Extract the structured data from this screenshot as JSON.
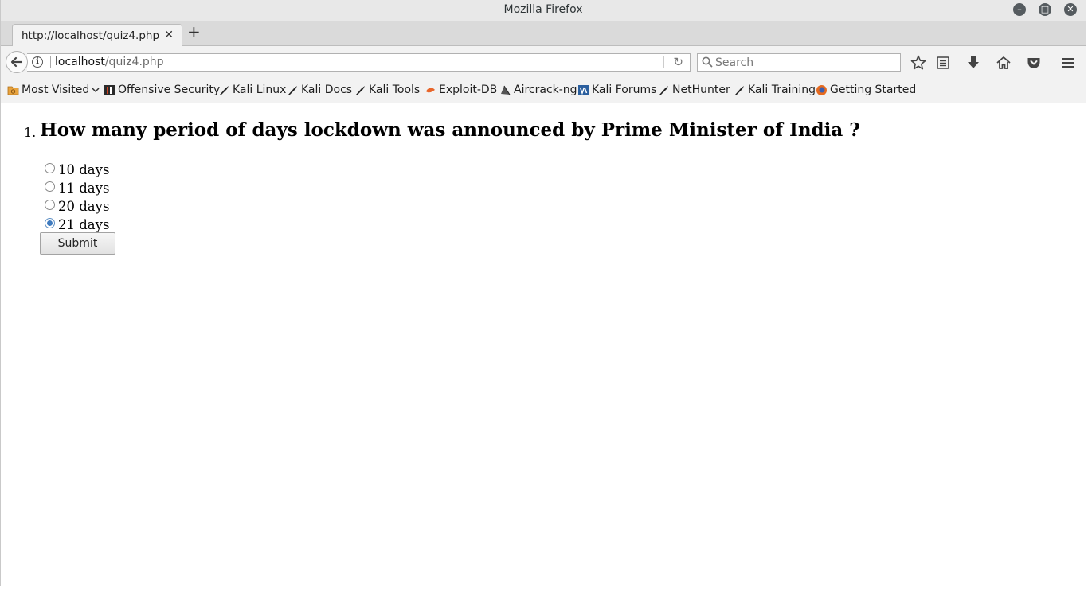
{
  "window": {
    "title": "Mozilla Firefox"
  },
  "tab": {
    "title": "http://localhost/quiz4.php"
  },
  "navbar": {
    "url_host": "localhost",
    "url_path": "/quiz4.php",
    "search_placeholder": "Search"
  },
  "bookmarks": [
    {
      "label": "Most Visited",
      "icon": "folder-icon"
    },
    {
      "label": "Offensive Security",
      "icon": "offsec-icon"
    },
    {
      "label": "Kali Linux",
      "icon": "kali-dragon-icon"
    },
    {
      "label": "Kali Docs",
      "icon": "kali-dragon-icon"
    },
    {
      "label": "Kali Tools",
      "icon": "kali-dragon-icon"
    },
    {
      "label": "Exploit-DB",
      "icon": "exploitdb-icon"
    },
    {
      "label": "Aircrack-ng",
      "icon": "aircrack-icon"
    },
    {
      "label": "Kali Forums",
      "icon": "forums-icon"
    },
    {
      "label": "NetHunter",
      "icon": "kali-dragon-icon"
    },
    {
      "label": "Kali Training",
      "icon": "kali-dragon-icon"
    },
    {
      "label": "Getting Started",
      "icon": "firefox-icon"
    }
  ],
  "quiz": {
    "number": "1.",
    "question": "How many period of days lockdown was announced by Prime Minister of India ?",
    "options": [
      {
        "label": "10 days",
        "checked": false
      },
      {
        "label": "11 days",
        "checked": false
      },
      {
        "label": "20 days",
        "checked": false
      },
      {
        "label": "21 days",
        "checked": true
      }
    ],
    "submit_label": "Submit"
  },
  "colors": {
    "radio_checked": "#3f7bbf",
    "titlebar": "#e8e8e8",
    "toolbar": "#f2f2f2"
  }
}
